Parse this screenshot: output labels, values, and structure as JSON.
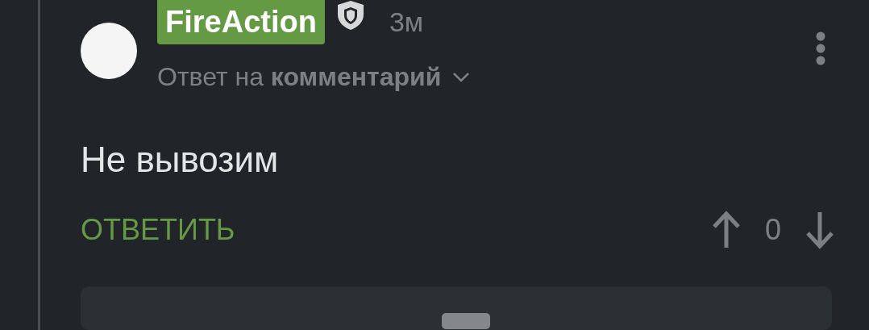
{
  "comment": {
    "author": {
      "name": "FireAction",
      "moderator": true
    },
    "time": "3м",
    "reply_to": "Ответ на **комментарий**",
    "text": "Не вывозим",
    "reply_button": "ОТВЕТИТЬ",
    "score": "0"
  },
  "next_item": {
    "kind": "card"
  }
}
